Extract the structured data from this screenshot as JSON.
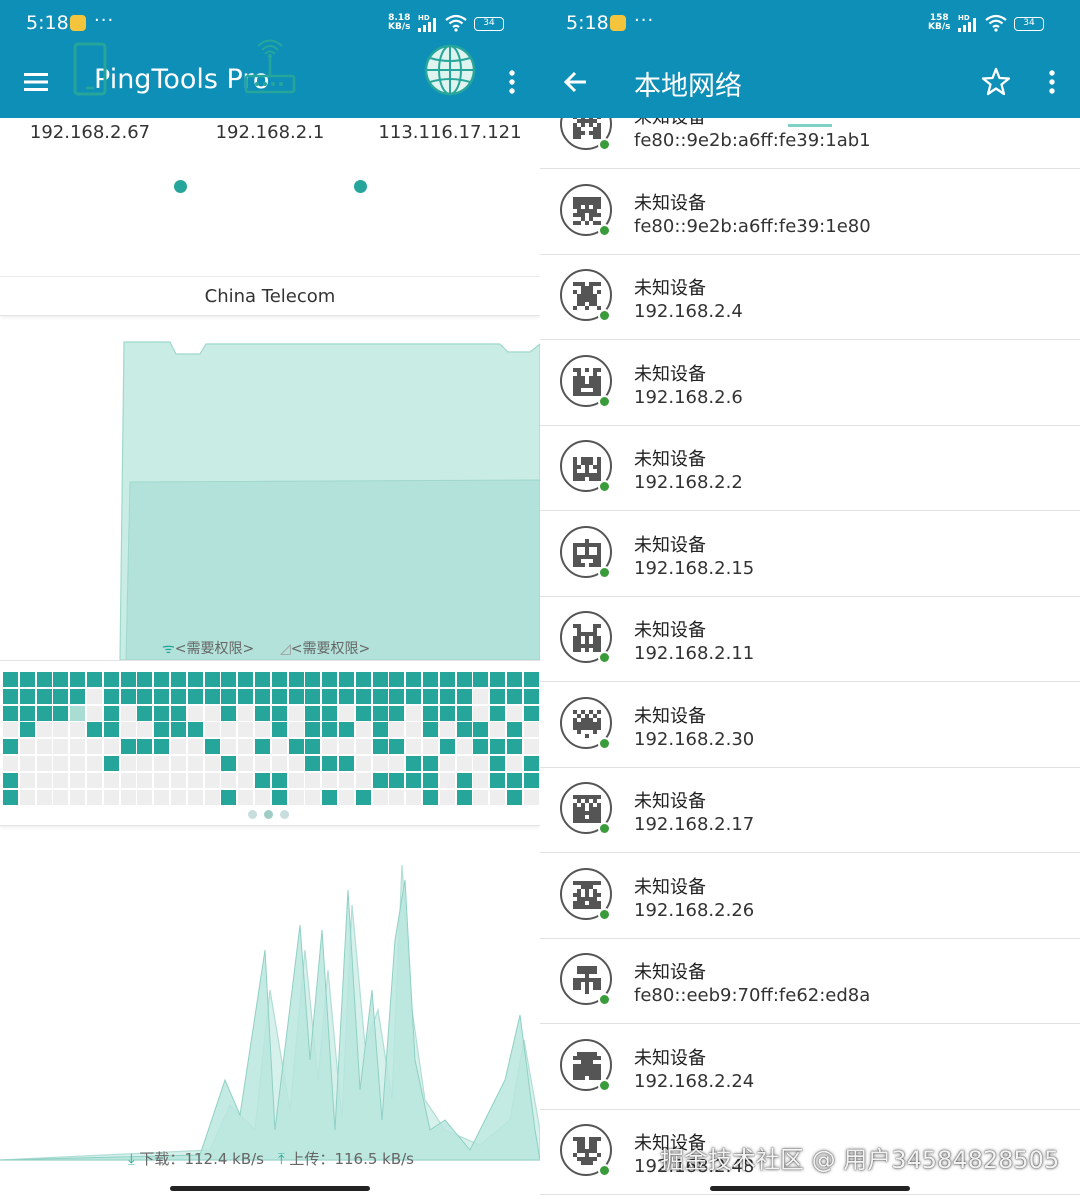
{
  "status_left": {
    "time": "5:18",
    "dots": "···",
    "speed_value": "8.18",
    "speed_unit": "KB/s",
    "hd": "HD",
    "battery": "34"
  },
  "status_right": {
    "time": "5:18",
    "dots": "···",
    "speed_value": "158",
    "speed_unit": "KB/s",
    "hd": "HD",
    "battery": "34"
  },
  "left_toolbar": {
    "title": "PingTools Pro",
    "menu_icon": "hamburger-menu-icon",
    "overflow_icon": "vertical-dots-icon"
  },
  "route": {
    "hops": [
      {
        "icon": "phone-icon",
        "ip": "192.168.2.67"
      },
      {
        "icon": "router-icon",
        "ip": "192.168.2.1"
      },
      {
        "icon": "globe-icon",
        "ip": "113.116.17.121"
      }
    ],
    "isp": "China Telecom"
  },
  "signal_panel": {
    "wifi_permission": "<需要权限>",
    "cell_permission": "<需要权限>"
  },
  "traffic": {
    "download_label": "下载：",
    "download_value": "112.4 kB/s",
    "upload_label": "上传：",
    "upload_value": "116.5 kB/s"
  },
  "right_toolbar": {
    "title": "本地网络",
    "back_icon": "back-arrow-icon",
    "star_icon": "star-outline-icon",
    "overflow_icon": "vertical-dots-icon"
  },
  "devices": [
    {
      "name": "未知设备",
      "ip": "fe80::9e2b:a6ff:fe39:1ab1"
    },
    {
      "name": "未知设备",
      "ip": "fe80::9e2b:a6ff:fe39:1e80"
    },
    {
      "name": "未知设备",
      "ip": "192.168.2.4"
    },
    {
      "name": "未知设备",
      "ip": "192.168.2.6"
    },
    {
      "name": "未知设备",
      "ip": "192.168.2.2"
    },
    {
      "name": "未知设备",
      "ip": "192.168.2.15"
    },
    {
      "name": "未知设备",
      "ip": "192.168.2.11"
    },
    {
      "name": "未知设备",
      "ip": "192.168.2.30"
    },
    {
      "name": "未知设备",
      "ip": "192.168.2.17"
    },
    {
      "name": "未知设备",
      "ip": "192.168.2.26"
    },
    {
      "name": "未知设备",
      "ip": "fe80::eeb9:70ff:fe62:ed8a"
    },
    {
      "name": "未知设备",
      "ip": "192.168.2.24"
    },
    {
      "name": "未知设备",
      "ip": "192.168.2.48"
    }
  ],
  "watermark": "掘金技术社区 @ 用户34584828505",
  "colors": {
    "toolbar": "#0e8fb8",
    "accent": "#26a69a",
    "chart_fill": "#b9e6de",
    "grid_empty": "#eeeeee",
    "online": "#3a9b3a"
  }
}
